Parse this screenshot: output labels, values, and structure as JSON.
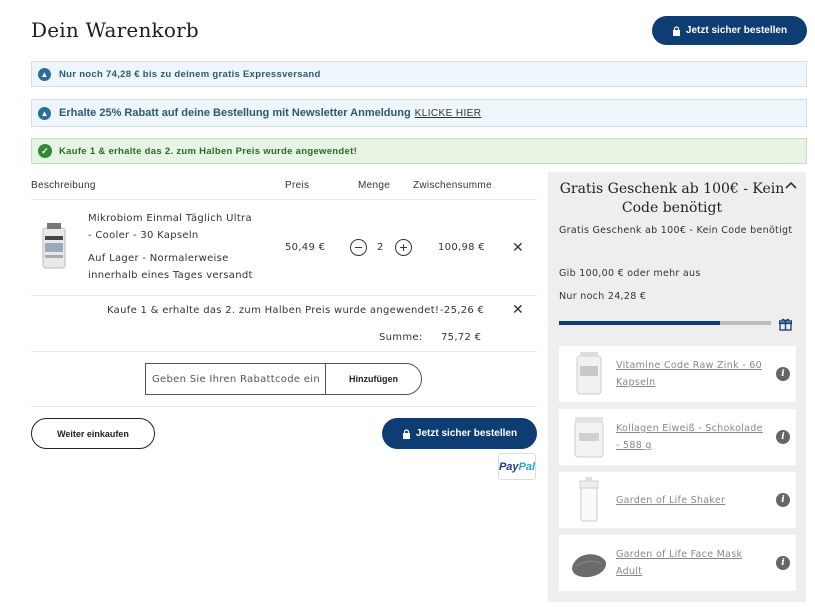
{
  "header": {
    "title": "Dein Warenkorb",
    "checkout_label": "Jetzt sicher bestellen"
  },
  "banners": {
    "shipping": "Nur noch 74,28 € bis zu deinem gratis Expressversand",
    "newsletter": "Erhalte 25% Rabatt auf deine Bestellung mit Newsletter Anmeldung",
    "newsletter_link": "KLICKE HIER",
    "promo_applied": "Kaufe 1 & erhalte das 2. zum Halben Preis wurde angewendet!"
  },
  "table": {
    "headers": {
      "description": "Beschreibung",
      "price": "Preis",
      "quantity": "Menge",
      "subtotal": "Zwischensumme"
    },
    "item": {
      "name_line1": "Mikrobiom Einmal Täglich Ultra",
      "name_line2": "- Cooler - 30 Kapseln",
      "stock_line1": "Auf Lager -  Normalerweise",
      "stock_line2": "innerhalb eines Tages versandt",
      "price": "50,49 €",
      "qty": "2",
      "minus": "−",
      "plus": "+",
      "subtotal": "100,98 €",
      "remove": "✕"
    },
    "discount": {
      "label": "Kaufe 1 & erhalte das 2. zum Halben Preis wurde angewendet!",
      "amount": "-25,26 €",
      "remove": "✕"
    },
    "sum": {
      "label": "Summe:",
      "value": "75,72 €"
    }
  },
  "coupon": {
    "placeholder": "Geben Sie Ihren Rabattcode ein",
    "button": "Hinzufügen"
  },
  "actions": {
    "continue": "Weiter einkaufen",
    "checkout": "Jetzt sicher bestellen",
    "paypal_a": "Pay",
    "paypal_b": "Pal"
  },
  "sidebar": {
    "title": "Gratis Geschenk ab 100€ - Kein Code benötigt",
    "subtitle": "Gratis Geschenk ab 100€ - Kein Code benötigt",
    "threshold": "Gib 100,00 € oder mehr aus",
    "remaining": "Nur noch 24,28 €",
    "progress": 0.76,
    "chevron": "^",
    "gifts": [
      {
        "name": "Vitamine Code Raw Zink - 60 Kapseln",
        "info": "i"
      },
      {
        "name": "Kollagen Eiweiß - Schokolade - 588 g",
        "info": "i"
      },
      {
        "name": "Garden of Life Shaker",
        "info": "i"
      },
      {
        "name": "Garden of Life Face Mask Adult",
        "info": "i"
      }
    ]
  },
  "colors": {
    "primary": "#0e3d73",
    "info_bg": "#eef6fb",
    "success_bg": "#e7f4e4",
    "sidebar_bg": "#eeeeee"
  }
}
